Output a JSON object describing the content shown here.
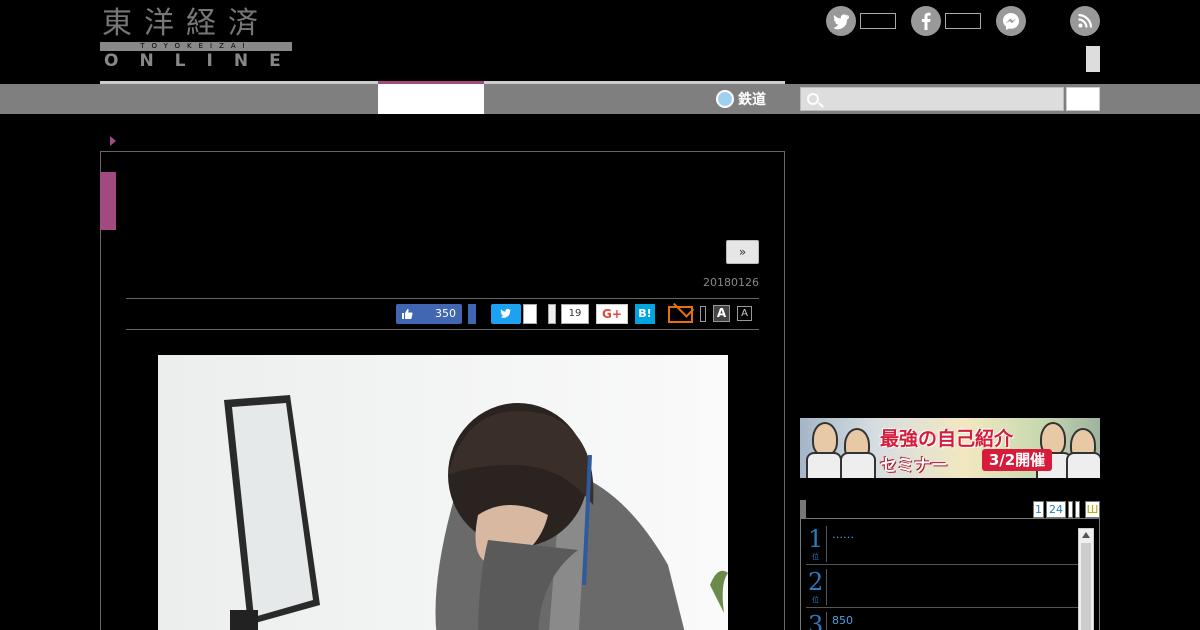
{
  "logo": {
    "kanji": "東洋経済",
    "romaji": "TOYOKEIZAI",
    "online": "ONLINE"
  },
  "nav": {
    "rail_label": "鉄道"
  },
  "search": {
    "placeholder": ""
  },
  "article": {
    "next_label": "»",
    "date": "20180126",
    "share": {
      "like_count": "350",
      "pocket_count": "19",
      "gplus_label": "G+",
      "hatena_label": "B!",
      "font_large_label": "A",
      "font_small_label": "A"
    }
  },
  "sidebar": {
    "banner": {
      "line1": "最強の自己紹介",
      "line2": "セミナー",
      "date": "3/2開催"
    },
    "ranking": {
      "pages": [
        "1",
        "24"
      ],
      "page_extra": "Ш",
      "items": [
        {
          "rank": "1",
          "unit": "位",
          "text": "……"
        },
        {
          "rank": "2",
          "unit": "位",
          "text": ""
        },
        {
          "rank": "3",
          "unit": "位",
          "text": "850"
        }
      ]
    }
  },
  "colors": {
    "accent": "#a04a7f",
    "nav_bg": "#7f7f7f",
    "twitter": "#1da1f2",
    "facebook": "#4267b2",
    "hatena": "#00a4de",
    "rank_blue": "#2b7bc0",
    "mail": "#e8700a"
  }
}
